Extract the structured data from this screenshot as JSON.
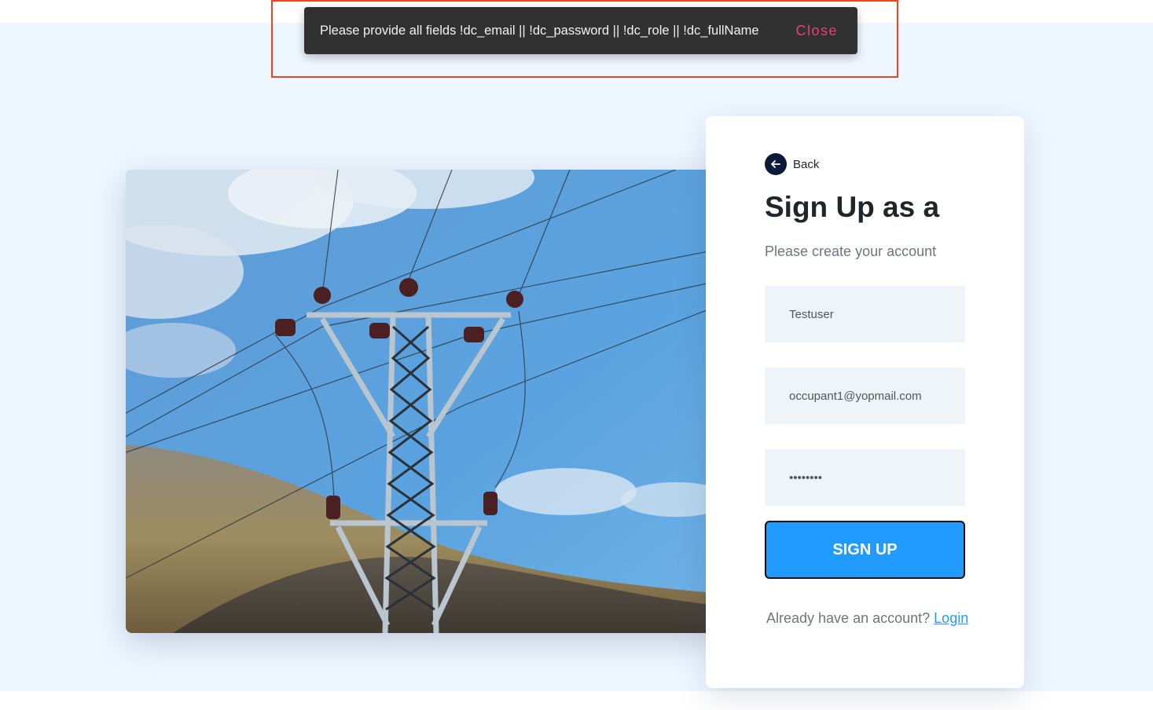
{
  "notification": {
    "message": "Please provide all fields !dc_email || !dc_password || !dc_role || !dc_fullName",
    "close_label": "Close"
  },
  "signup_card": {
    "back_label": "Back",
    "title": "Sign Up as a",
    "subtitle": "Please create your account",
    "fields": {
      "full_name_value": "Testuser",
      "email_value": "occupant1@yopmail.com",
      "password_value": "••••••••"
    },
    "submit_label": "SIGN UP",
    "login_prompt": "Already have an account?",
    "login_link": "Login"
  },
  "colors": {
    "page_background": "#eef6ff",
    "primary_button": "#219bff",
    "toast_background": "#313131",
    "toast_action": "#e8407a",
    "highlight_outline": "#f0431f"
  },
  "icons": {
    "back": "arrow-left-icon"
  }
}
